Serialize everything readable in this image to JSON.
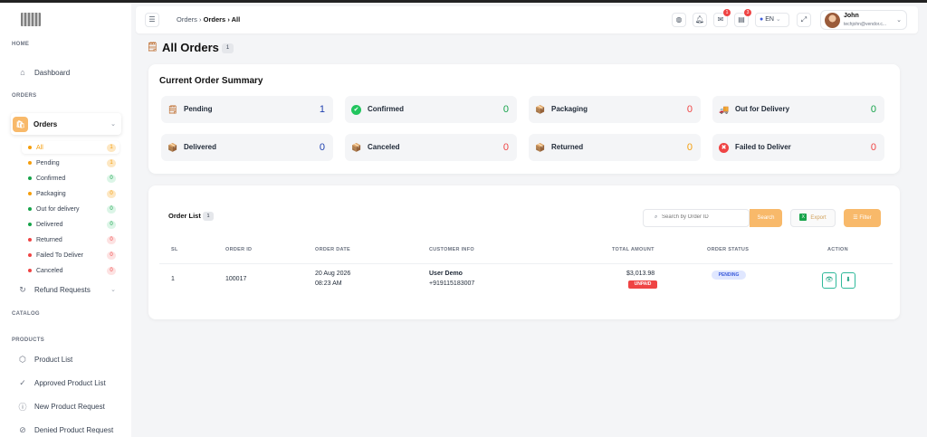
{
  "sidebar": {
    "sections": {
      "home": "HOME",
      "orders": "ORDERS",
      "catalog": "CATALOG",
      "products": "PRODUCTS"
    },
    "dashboard": "Dashboard",
    "orders_label": "Orders",
    "order_subitems": [
      {
        "label": "All",
        "count": "1",
        "dot": "#f59e0b",
        "bg": "#fde7c2",
        "fg": "#f59e0b"
      },
      {
        "label": "Pending",
        "count": "1",
        "dot": "#f59e0b",
        "bg": "#fde7c2",
        "fg": "#f59e0b"
      },
      {
        "label": "Confirmed",
        "count": "0",
        "dot": "#16a34a",
        "bg": "#dcf5e7",
        "fg": "#16a34a"
      },
      {
        "label": "Packaging",
        "count": "0",
        "dot": "#f59e0b",
        "bg": "#fde7c2",
        "fg": "#f59e0b"
      },
      {
        "label": "Out for delivery",
        "count": "0",
        "dot": "#16a34a",
        "bg": "#dcf5e7",
        "fg": "#16a34a"
      },
      {
        "label": "Delivered",
        "count": "0",
        "dot": "#16a34a",
        "bg": "#dcf5e7",
        "fg": "#16a34a"
      },
      {
        "label": "Returned",
        "count": "0",
        "dot": "#ef4444",
        "bg": "#fde2e2",
        "fg": "#ef4444"
      },
      {
        "label": "Failed To Deliver",
        "count": "0",
        "dot": "#ef4444",
        "bg": "#fde2e2",
        "fg": "#ef4444"
      },
      {
        "label": "Canceled",
        "count": "0",
        "dot": "#ef4444",
        "bg": "#fde2e2",
        "fg": "#ef4444"
      }
    ],
    "refund": "Refund Requests",
    "product_list": "Product List",
    "approved_list": "Approved Product List",
    "new_request": "New Product Request",
    "denied_request": "Denied Product Request"
  },
  "header": {
    "crumb1": "Orders",
    "crumb2": "Orders",
    "crumb3": "All",
    "badge_messages": "1",
    "badge_cart": "3",
    "lang": "EN",
    "user_name": "John",
    "user_email": "techjohn@vendor.c..."
  },
  "page": {
    "title": "All Orders",
    "count": "1"
  },
  "summary": {
    "title": "Current Order Summary",
    "tiles": [
      {
        "label": "Pending",
        "value": "1",
        "color": "#1e40af",
        "icon": "pending-icon",
        "glyph": "🗒"
      },
      {
        "label": "Confirmed",
        "value": "0",
        "color": "#16a34a",
        "icon": "confirmed-icon",
        "glyph": "✔"
      },
      {
        "label": "Packaging",
        "value": "0",
        "color": "#ef4444",
        "icon": "packaging-icon",
        "glyph": "📦"
      },
      {
        "label": "Out for Delivery",
        "value": "0",
        "color": "#16a34a",
        "icon": "delivery-truck-icon",
        "glyph": "🚚"
      },
      {
        "label": "Delivered",
        "value": "0",
        "color": "#1e40af",
        "icon": "delivered-icon",
        "glyph": "📦"
      },
      {
        "label": "Canceled",
        "value": "0",
        "color": "#ef4444",
        "icon": "canceled-icon",
        "glyph": "📦"
      },
      {
        "label": "Returned",
        "value": "0",
        "color": "#f59e0b",
        "icon": "returned-icon",
        "glyph": "📦"
      },
      {
        "label": "Failed to Deliver",
        "value": "0",
        "color": "#ef4444",
        "icon": "failed-icon",
        "glyph": "✖"
      }
    ]
  },
  "order_list": {
    "title": "Order List",
    "count": "1",
    "search_placeholder": "Search by Order ID",
    "search_btn": "Search",
    "export_btn": "Export",
    "filter_btn": "Filter",
    "columns": [
      "SL",
      "ORDER ID",
      "ORDER DATE",
      "CUSTOMER INFO",
      "TOTAL AMOUNT",
      "ORDER STATUS",
      "ACTION"
    ],
    "rows": [
      {
        "sl": "1",
        "order_id": "100017",
        "date": "20 Aug 2026",
        "time": "08:23 AM",
        "customer": "User Demo",
        "phone": "+919115183007",
        "amount": "$3,013.98",
        "payment": "UNPAID",
        "status": "PENDING"
      }
    ]
  }
}
